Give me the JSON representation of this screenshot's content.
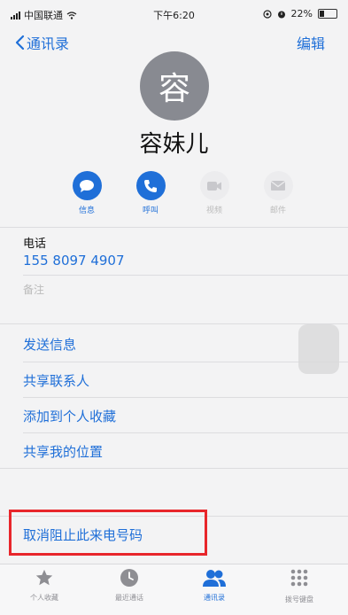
{
  "status_bar": {
    "carrier": "中国联通",
    "time": "下午6:20",
    "battery": "22%"
  },
  "nav": {
    "back_label": "通讯录",
    "edit_label": "编辑"
  },
  "contact": {
    "avatar_char": "容",
    "name": "容妹儿"
  },
  "actions": [
    {
      "label": "信息",
      "enabled": true,
      "icon": "message-icon"
    },
    {
      "label": "呼叫",
      "enabled": true,
      "icon": "phone-icon"
    },
    {
      "label": "视频",
      "enabled": false,
      "icon": "video-icon"
    },
    {
      "label": "邮件",
      "enabled": false,
      "icon": "mail-icon"
    }
  ],
  "phone": {
    "label": "电话",
    "number": "155 8097 4907"
  },
  "notes_label": "备注",
  "options": [
    "发送信息",
    "共享联系人",
    "添加到个人收藏",
    "共享我的位置"
  ],
  "block": {
    "label": "取消阻止此来电号码"
  },
  "tabs": [
    {
      "label": "个人收藏",
      "active": false,
      "icon": "star-icon"
    },
    {
      "label": "最近通话",
      "active": false,
      "icon": "clock-icon"
    },
    {
      "label": "通讯录",
      "active": true,
      "icon": "contacts-icon"
    },
    {
      "label": "拨号键盘",
      "active": false,
      "icon": "keypad-icon"
    }
  ],
  "colors": {
    "accent": "#1f6fd8",
    "highlight": "#e8262b",
    "avatar": "#888a91"
  }
}
